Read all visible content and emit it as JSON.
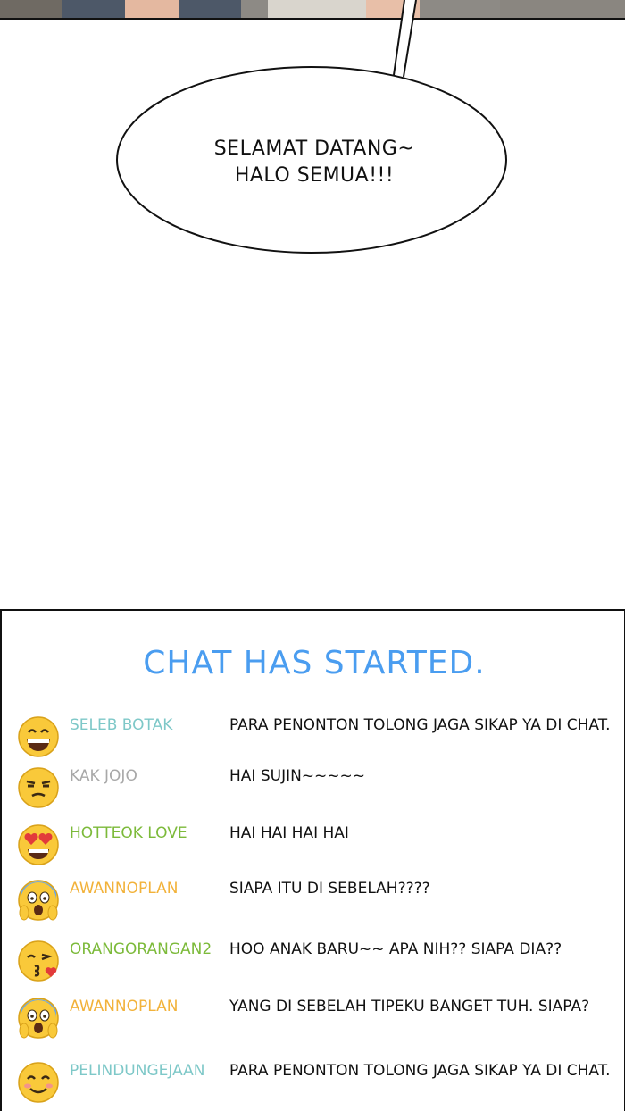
{
  "speech_bubble": {
    "line1": "SELAMAT DATANG~",
    "line2": "HALO SEMUA!!!"
  },
  "chat": {
    "title": "CHAT HAS STARTED.",
    "messages": [
      {
        "user": "SELEB BOTAK",
        "user_color": "#7ec8c8",
        "emoji": "grinning-face-icon",
        "text": "PARA PENONTON TOLONG JAGA SIKAP YA DI CHAT."
      },
      {
        "user": "KAK JOJO",
        "user_color": "#a8a8a8",
        "emoji": "unamused-face-icon",
        "text": "HAI SUJIN~~~~~"
      },
      {
        "user": "HOTTEOK LOVE",
        "user_color": "#7cba3a",
        "emoji": "heart-eyes-face-icon",
        "text": "HAI HAI HAI HAI"
      },
      {
        "user": "AWANNOPLAN",
        "user_color": "#f2b23a",
        "emoji": "screaming-face-icon",
        "text": "SIAPA ITU DI SEBELAH????"
      },
      {
        "user": "ORANGORANGAN2",
        "user_color": "#7cba3a",
        "emoji": "kissing-face-icon",
        "text": "HOO ANAK BARU~~ APA NIH?? SIAPA DIA??"
      },
      {
        "user": "AWANNOPLAN",
        "user_color": "#f2b23a",
        "emoji": "screaming-face-icon",
        "text": "YANG DI SEBELAH TIPEKU BANGET TUH. SIAPA?"
      },
      {
        "user": "PELINDUNGEJAAN",
        "user_color": "#7ec8c8",
        "emoji": "smiling-face-icon",
        "text": "PARA PENONTON TOLONG JAGA SIKAP YA DI CHAT."
      }
    ]
  }
}
